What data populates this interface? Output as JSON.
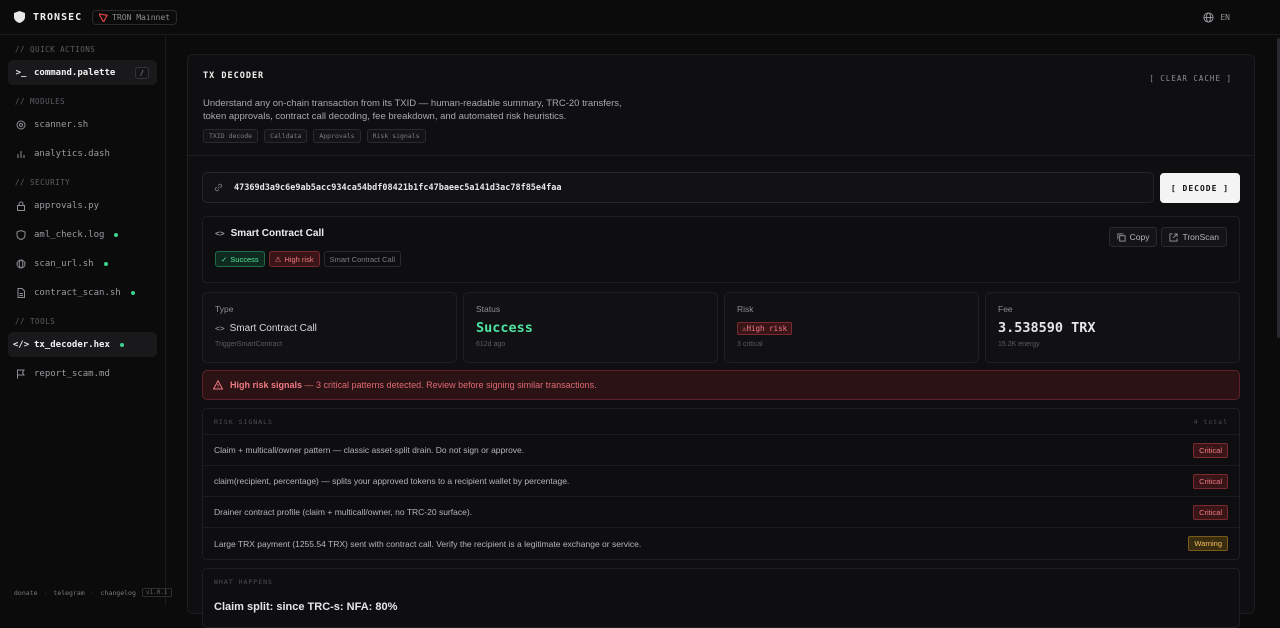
{
  "topbar": {
    "brand": "TRONSEC",
    "network": "TRON Mainnet",
    "language": "EN"
  },
  "sidebar": {
    "sections": {
      "quick_actions": "// QUICK ACTIONS",
      "modules": "// MODULES",
      "security": "// SECURITY",
      "tools": "// TOOLS"
    },
    "command_palette": {
      "label": "command.palette",
      "shortcut": "/"
    },
    "items": {
      "scanner": "scanner.sh",
      "analytics": "analytics.dash",
      "approvals": "approvals.py",
      "aml_check": "aml_check.log",
      "scan_url": "scan_url.sh",
      "contract_scan": "contract_scan.sh",
      "tx_decoder": "tx_decoder.hex",
      "report_scam": "report_scam.md"
    },
    "footer": {
      "donate": "donate",
      "telegram": "telegram",
      "changelog": "changelog",
      "version": "v1.0.1"
    }
  },
  "panel": {
    "title": "TX DECODER",
    "clear_cache": "[ CLEAR CACHE ]",
    "description": "Understand any on-chain transaction from its TXID — human-readable summary, TRC-20 transfers, token approvals, contract call decoding, fee breakdown, and automated risk heuristics.",
    "chips": [
      "TXID decode",
      "Calldata",
      "Approvals",
      "Risk signals"
    ]
  },
  "tx_input": {
    "value": "47369d3a9c6e9ab5acc934ca54bdf08421b1fc47baeec5a141d3ac78f85e4faa",
    "decode_label": "[ DECODE ]"
  },
  "call_card": {
    "title": "Smart Contract Call",
    "copy_label": "Copy",
    "tronscan_label": "TronScan",
    "tags": {
      "success": "Success",
      "risk": "High risk",
      "type": "Smart Contract Call"
    }
  },
  "stats": {
    "type": {
      "label": "Type",
      "value": "Smart Contract Call",
      "sub": "TriggerSmartContract"
    },
    "status": {
      "label": "Status",
      "value": "Success",
      "sub": "612d ago"
    },
    "risk": {
      "label": "Risk",
      "value": "High risk",
      "sub": "3 critical"
    },
    "fee": {
      "label": "Fee",
      "value": "3.538590 TRX",
      "sub": "15.2K energy"
    }
  },
  "alert": {
    "strong": "High risk signals",
    "text": " — 3 critical patterns detected. Review before signing similar transactions."
  },
  "signals": {
    "header": "RISK SIGNALS",
    "total": "4 total",
    "rows": [
      {
        "text": "Claim + multicall/owner pattern — classic asset-split drain. Do not sign or approve.",
        "severity": "Critical"
      },
      {
        "text": "claim(recipient, percentage) — splits your approved tokens to a recipient wallet by percentage.",
        "severity": "Critical"
      },
      {
        "text": "Drainer contract profile (claim + multicall/owner, no TRC-20 surface).",
        "severity": "Critical"
      },
      {
        "text": "Large TRX payment (1255.54 TRX) sent with contract call. Verify the recipient is a legitimate exchange or service.",
        "severity": "Warning"
      }
    ]
  },
  "what_happens": {
    "header": "WHAT HAPPENS",
    "text": "Claim split: since TRC-s: NFA: 80%"
  },
  "colors": {
    "accent_green": "#4ee3a0",
    "risk_red": "#f07a82",
    "warning_amber": "#f0c060"
  }
}
